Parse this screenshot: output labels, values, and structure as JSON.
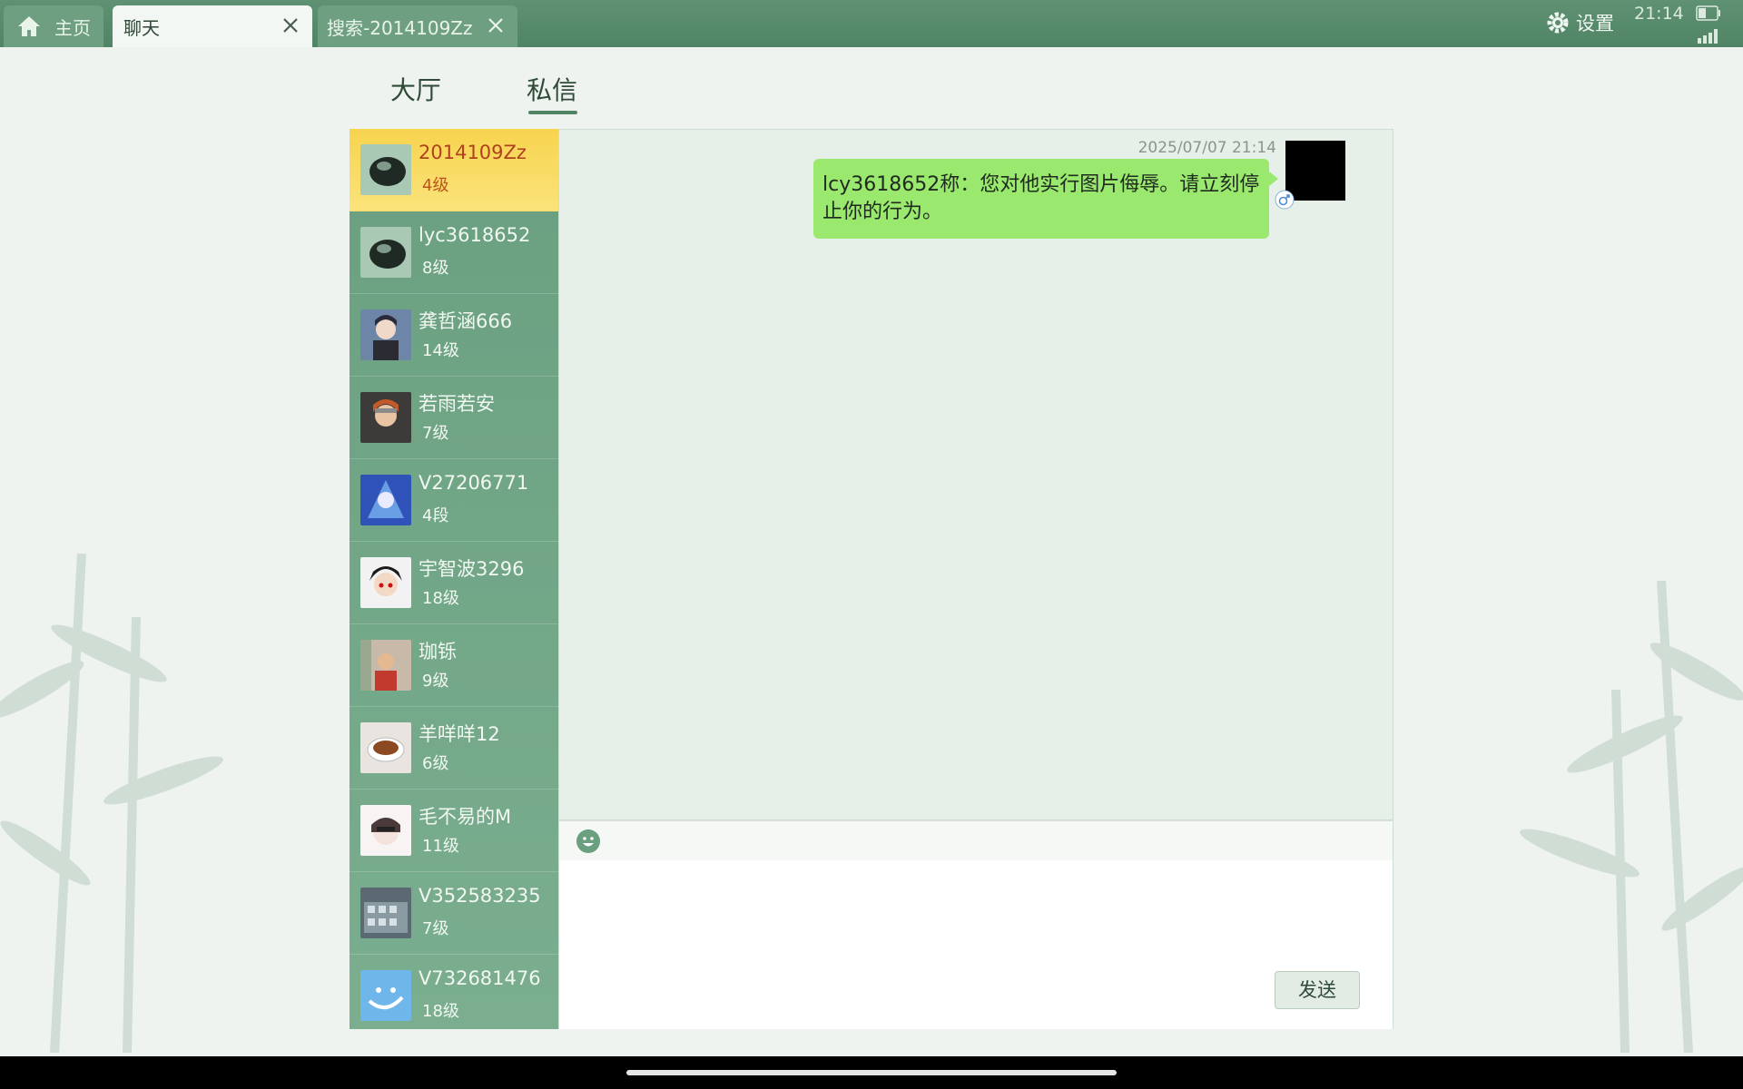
{
  "tabs": {
    "home": "主页",
    "chat": "聊天",
    "search": "搜索-2014109Zz"
  },
  "status": {
    "settings": "设置",
    "time": "21:14"
  },
  "subtabs": {
    "hall": "大厅",
    "private": "私信"
  },
  "contacts": [
    {
      "name": "2014109Zz",
      "level": "4级"
    },
    {
      "name": "lyc3618652",
      "level": "8级"
    },
    {
      "name": "龚哲涵666",
      "level": "14级"
    },
    {
      "name": "若雨若安",
      "level": "7级"
    },
    {
      "name": "V27206771",
      "level": "4段"
    },
    {
      "name": "宇智波3296",
      "level": "18级"
    },
    {
      "name": "珈铄",
      "level": "9级"
    },
    {
      "name": "羊咩咩12",
      "level": "6级"
    },
    {
      "name": "毛不易的M",
      "level": "11级"
    },
    {
      "name": "V352583235",
      "level": "7级"
    },
    {
      "name": "V732681476",
      "level": "18级"
    }
  ],
  "message": {
    "timestamp": "2025/07/07 21:14",
    "text": "lcy3618652称：您对他实行图片侮辱。请立刻停止你的行为。"
  },
  "composer": {
    "send_label": "发送"
  },
  "colors": {
    "topbar": "#5f9273",
    "active_contact": "#f7d44e",
    "bubble": "#9ae86d",
    "contact_list": "#6a9f80"
  }
}
